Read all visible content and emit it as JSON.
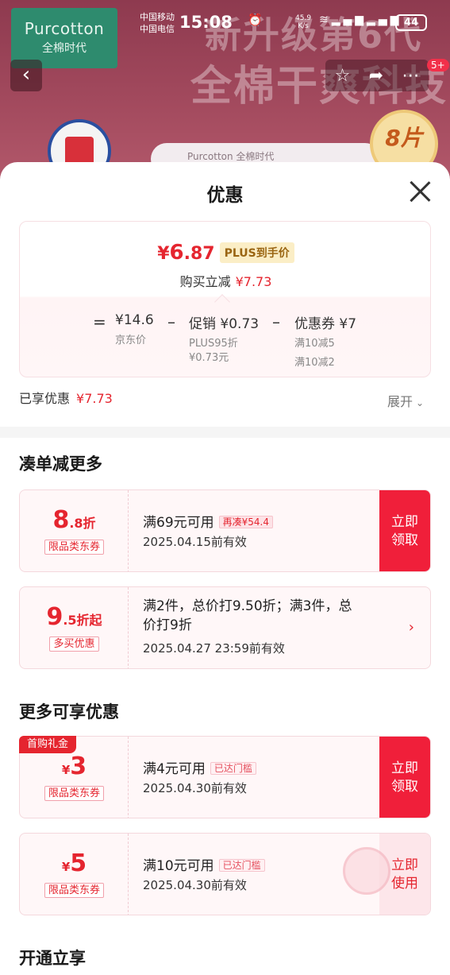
{
  "status_bar": {
    "carrier1": "中国移动",
    "carrier2": "中国电信",
    "time": "15:08",
    "net_speed_value": "45.9",
    "net_speed_unit": "K/s",
    "battery": "44",
    "icons": [
      "alarm-icon",
      "bluetooth-icon",
      "wifi-icon",
      "signal-4g-icon",
      "signal-5g-icon"
    ]
  },
  "background": {
    "brand_en": "Purcotton",
    "brand_cn": "全棉时代",
    "promo_line1": "新升级第6代",
    "promo_line2": "全棉干爽科技",
    "cart_badge": "5+",
    "package_label": "Purcotton 全棉时代",
    "pack_badge": "8片"
  },
  "sheet": {
    "title": "优惠",
    "price_card": {
      "final_price_symbol": "¥",
      "final_price_int": "6",
      "final_price_dec": ".87",
      "plus_tag": "PLUS到手价",
      "reduce_label": "购买立减",
      "reduce_amount": "¥7.73",
      "eq": "=",
      "jd_price": "¥14.6",
      "jd_price_label": "京东价",
      "minus1": "–",
      "promo": "促销 ¥0.73",
      "promo_sub1": "PLUS95折",
      "promo_sub2": "¥0.73元",
      "minus2": "–",
      "coupon": "优惠券 ¥7",
      "coupon_sub1": "满10减5",
      "coupon_sub2": "满10减2"
    },
    "saved_label": "已享优惠",
    "saved_amount": "¥7.73",
    "expand_label": "展开",
    "section1_title": "凑单减更多",
    "coupons_section1": [
      {
        "amount_big": "8",
        "amount_small": ".8折",
        "tag": "限品类东券",
        "condition": "满69元可用",
        "condition_tag": "再凑¥54.4",
        "date": "2025.04.15前有效",
        "action_line1": "立即",
        "action_line2": "领取"
      },
      {
        "amount_big": "9",
        "amount_small": ".5折起",
        "tag": "多买优惠",
        "condition_line1": "满2件，总价打9.50折；满3件，总",
        "condition_line2": "价打9折",
        "date": "2025.04.27 23:59前有效"
      }
    ],
    "section2_title": "更多可享优惠",
    "coupons_section2": [
      {
        "corner_tag": "首购礼金",
        "yen": "¥",
        "amount_big": "3",
        "tag": "限品类东券",
        "condition": "满4元可用",
        "condition_tag": "已达门槛",
        "date": "2025.04.30前有效",
        "action_line1": "立即",
        "action_line2": "领取"
      },
      {
        "yen": "¥",
        "amount_big": "5",
        "tag": "限品类东券",
        "condition": "满10元可用",
        "condition_tag": "已达门槛",
        "date": "2025.04.30前有效",
        "action_line1": "立即",
        "action_line2": "使用"
      }
    ],
    "section3_title": "开通立享"
  },
  "colors": {
    "accent_red": "#e5252f",
    "claim_red": "#f01f3a",
    "plus_gold": "#9a6512"
  }
}
